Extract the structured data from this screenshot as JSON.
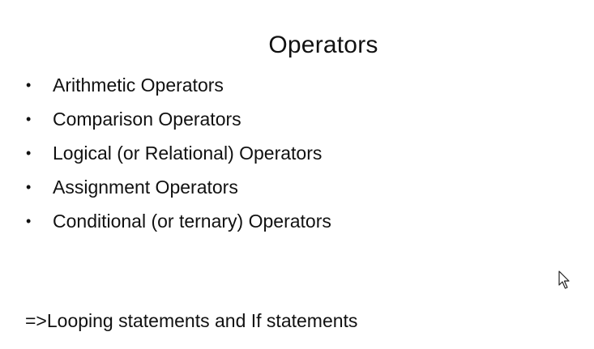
{
  "slide": {
    "title": "Operators",
    "bullets": [
      "Arithmetic Operators",
      "Comparison Operators",
      "Logical (or Relational) Operators",
      "Assignment Operators",
      "Conditional (or ternary) Operators"
    ],
    "bullet_symbol": "•",
    "footer": "=>Looping statements and If statements"
  },
  "cursor": {
    "icon": "mouse-pointer-icon"
  }
}
